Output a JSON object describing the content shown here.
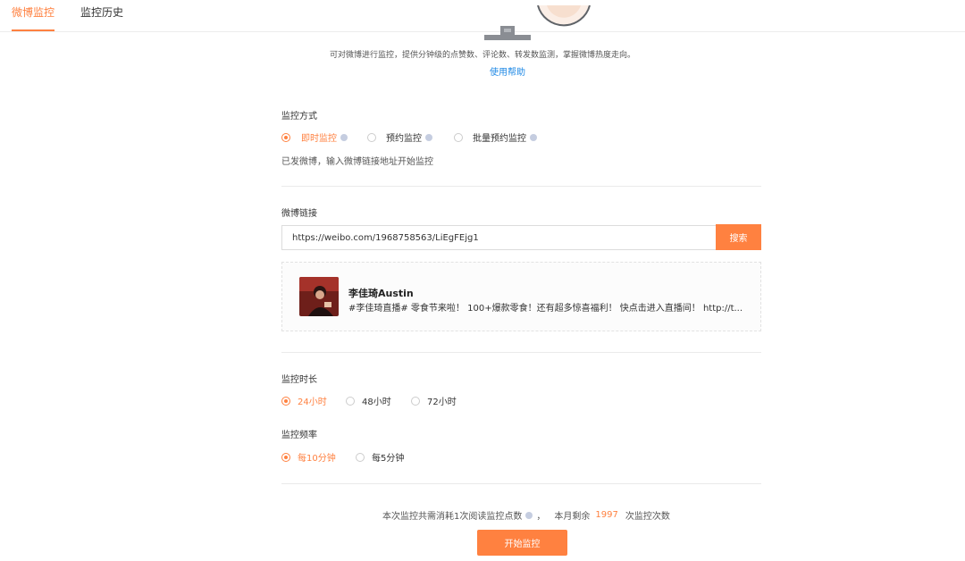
{
  "tabs": [
    {
      "label": "微博监控",
      "active": true
    },
    {
      "label": "监控历史",
      "active": false
    }
  ],
  "hero": {
    "description": "可对微博进行监控，提供分钟级的点赞数、评论数、转发数监测，掌握微博热度走向。",
    "help_link": "使用帮助"
  },
  "monitor_method": {
    "title": "监控方式",
    "options": [
      {
        "label": "即时监控",
        "checked": true
      },
      {
        "label": "预约监控",
        "checked": false
      },
      {
        "label": "批量预约监控",
        "checked": false
      }
    ],
    "hint": "已发微博，输入微博链接地址开始监控"
  },
  "weibo_link": {
    "title": "微博链接",
    "input_value": "https://weibo.com/1968758563/LiEgFEjg1",
    "search_label": "搜索"
  },
  "post": {
    "author": "李佳琦Austin",
    "text": "#李佳琦直播# 零食节来啦！ 100+爆款零食！还有超多惊喜福利！ 快点击进入直播间！ http://t..."
  },
  "duration": {
    "title": "监控时长",
    "options": [
      {
        "label": "24小时",
        "checked": true
      },
      {
        "label": "48小时",
        "checked": false
      },
      {
        "label": "72小时",
        "checked": false
      }
    ]
  },
  "frequency": {
    "title": "监控频率",
    "options": [
      {
        "label": "每10分钟",
        "checked": true
      },
      {
        "label": "每5分钟",
        "checked": false
      }
    ]
  },
  "footer": {
    "consume_text": "本次监控共需消耗1次阅读监控点数",
    "separator": "，",
    "remaining_prefix": "本月剩余",
    "remaining_count": "1997",
    "remaining_suffix": "次监控次数",
    "start_label": "开始监控"
  },
  "colors": {
    "accent": "#ff8140",
    "link": "#1e88e5",
    "info_dot": "#c5cde0"
  }
}
